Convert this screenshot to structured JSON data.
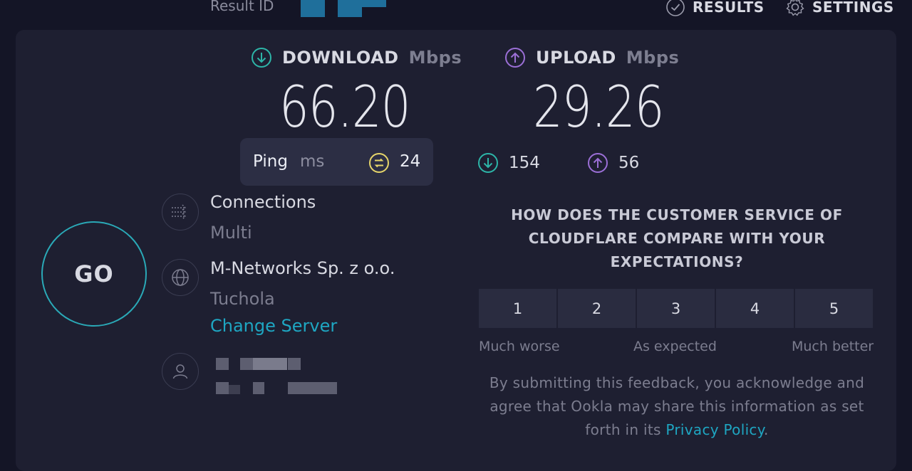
{
  "header": {
    "result_id_label": "Result ID",
    "results_label": "RESULTS",
    "settings_label": "SETTINGS"
  },
  "download": {
    "label": "DOWNLOAD",
    "unit": "Mbps",
    "value": "66.20",
    "icon": "arrow-down-circle-icon",
    "color": "#2db5a8"
  },
  "upload": {
    "label": "UPLOAD",
    "unit": "Mbps",
    "value": "29.26",
    "icon": "arrow-up-circle-icon",
    "color": "#9b6fd6"
  },
  "ping": {
    "label": "Ping",
    "unit": "ms",
    "value": "24",
    "icon": "ping-icon",
    "color": "#e6d56a"
  },
  "latency": {
    "download_value": "154",
    "upload_value": "56"
  },
  "go_label": "GO",
  "connections": {
    "title": "Connections",
    "value": "Multi"
  },
  "server": {
    "provider": "M-Networks Sp. z o.o.",
    "city": "Tuchola",
    "change_label": "Change Server"
  },
  "survey": {
    "question": "HOW DOES THE CUSTOMER SERVICE OF CLOUDFLARE COMPARE WITH YOUR EXPECTATIONS?",
    "options": [
      "1",
      "2",
      "3",
      "4",
      "5"
    ],
    "low_label": "Much worse",
    "mid_label": "As expected",
    "high_label": "Much better",
    "legal_text": "By submitting this feedback, you acknowledge and agree that Ookla may share this information as set forth in its",
    "privacy_link": "Privacy Policy",
    "legal_end": "."
  },
  "colors": {
    "accent": "#1ea6c2",
    "go_ring": "#2aa9b7",
    "background": "#141526",
    "panel": "#1e1f31"
  }
}
